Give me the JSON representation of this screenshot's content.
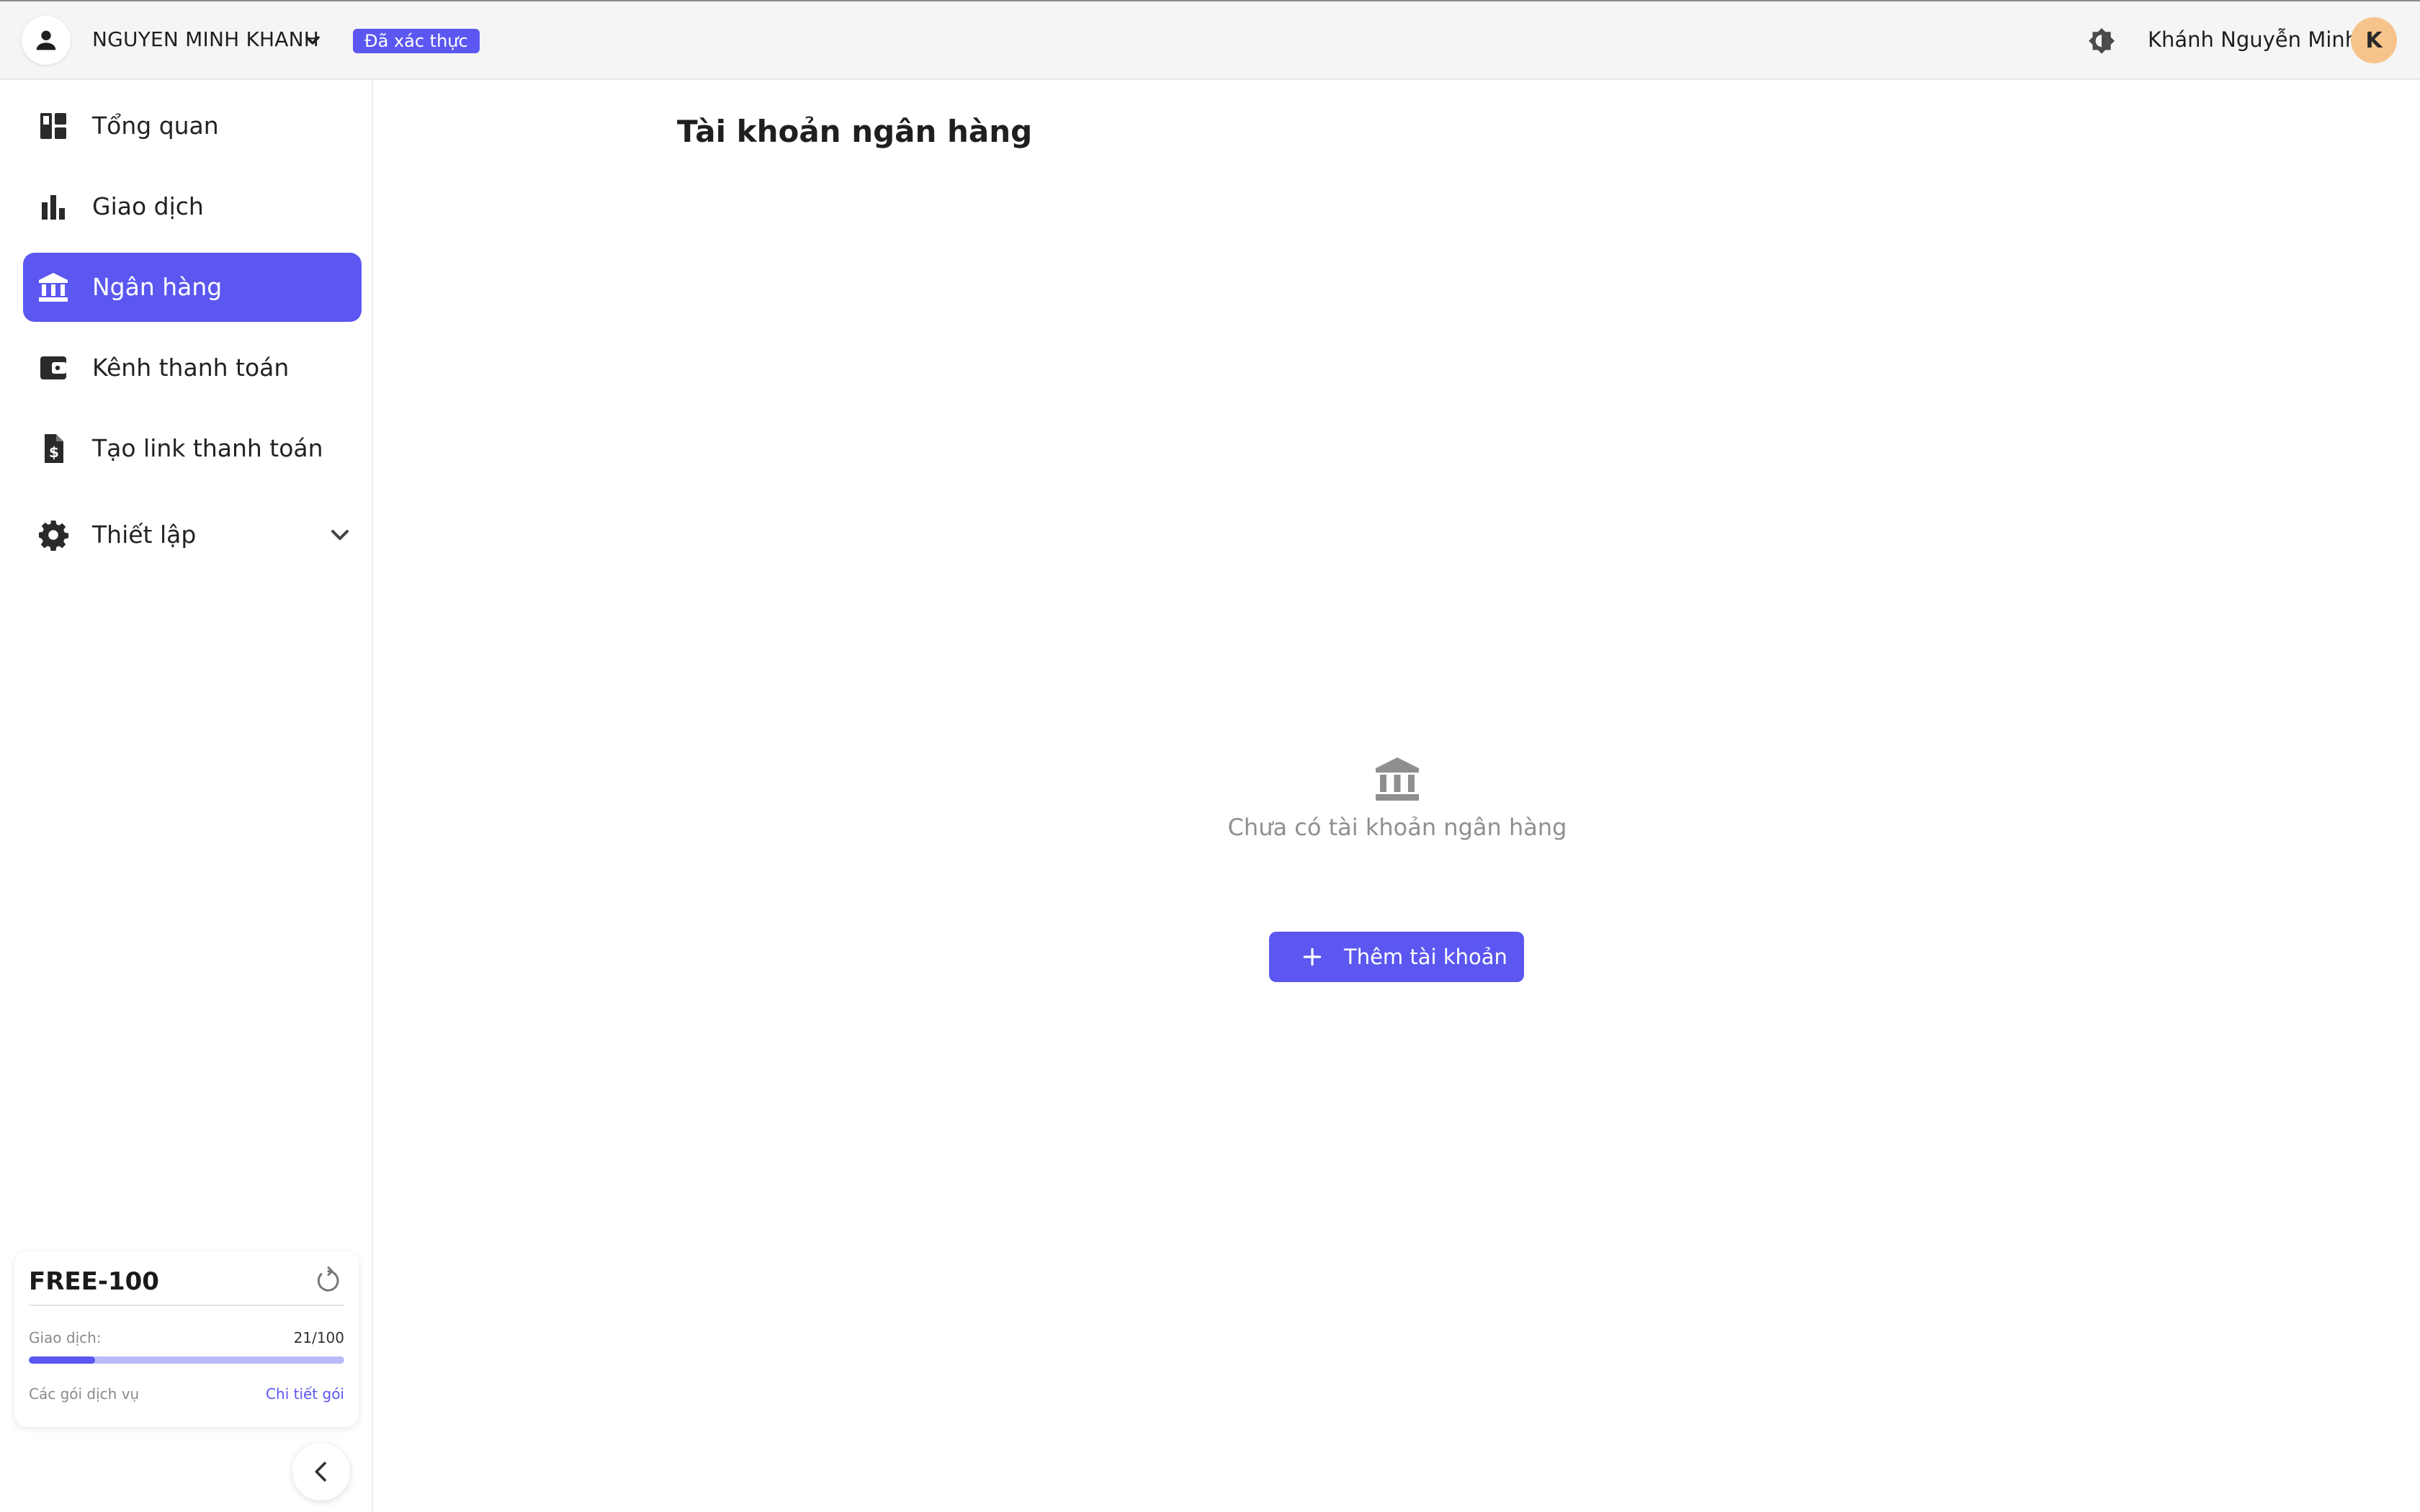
{
  "header": {
    "account_name": "NGUYEN MINH KHANH",
    "verified_badge": "Đã xác thực",
    "user_name": "Khánh Nguyễn Minh",
    "user_initial": "K"
  },
  "sidebar": {
    "items": [
      {
        "label": "Tổng quan",
        "icon": "dashboard-icon"
      },
      {
        "label": "Giao dịch",
        "icon": "bar-chart-icon"
      },
      {
        "label": "Ngân hàng",
        "icon": "bank-icon",
        "active": true
      },
      {
        "label": "Kênh thanh toán",
        "icon": "wallet-icon"
      },
      {
        "label": "Tạo link thanh toán",
        "icon": "invoice-dollar-icon"
      },
      {
        "label": "Thiết lập",
        "icon": "gear-icon",
        "expandable": true
      }
    ]
  },
  "plan": {
    "name": "FREE-100",
    "transactions_label": "Giao dịch:",
    "transactions_count": "21/100",
    "usage_fraction": 0.21,
    "services_label": "Các gói dịch vụ",
    "details_link": "Chi tiết gói"
  },
  "main": {
    "title": "Tài khoản ngân hàng",
    "empty_text": "Chưa có tài khoản ngân hàng",
    "add_button": "Thêm tài khoản"
  },
  "colors": {
    "accent": "#5b57f0",
    "avatar": "#f6c48a"
  }
}
